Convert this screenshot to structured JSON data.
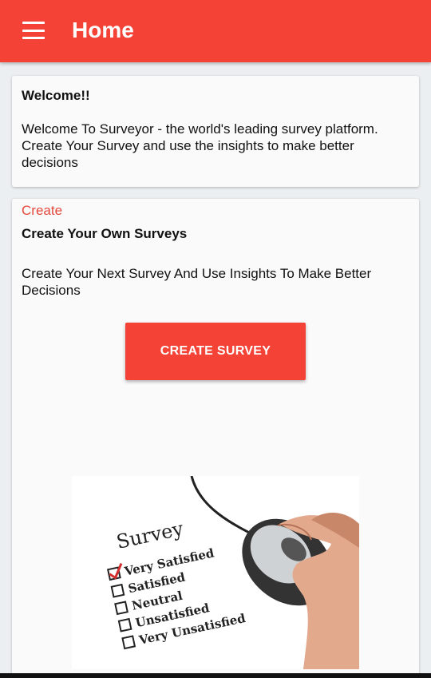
{
  "appbar": {
    "title": "Home",
    "menu_icon": "hamburger-menu-icon",
    "color": "#f44336"
  },
  "welcome_card": {
    "heading": "Welcome!!",
    "body": "Welcome To Surveyor - the world's leading survey platform. Create Your Survey and use the insights to make better decisions"
  },
  "create_card": {
    "label": "Create",
    "heading": "Create Your Own Surveys",
    "body": "Create Your Next Survey And Use Insights To Make Better Decisions",
    "button_label": "CREATE SURVEY",
    "accent_color": "#e5493d"
  },
  "survey_image": {
    "title": "Survey",
    "options": [
      "Very Satisfied",
      "Satisfied",
      "Neutral",
      "Unsatisfied",
      "Very Unsatisfied"
    ]
  }
}
